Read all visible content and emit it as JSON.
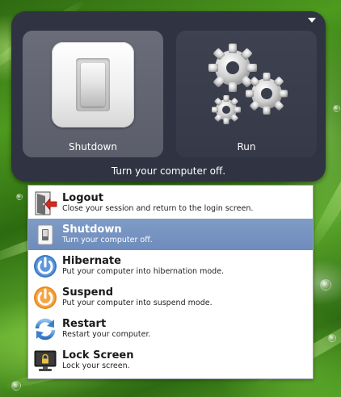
{
  "panel": {
    "caption": "Turn your computer off.",
    "tiles": [
      {
        "label": "Shutdown",
        "selected": true
      },
      {
        "label": "Run",
        "selected": false
      }
    ]
  },
  "menu": {
    "items": [
      {
        "title": "Logout",
        "desc": "Close your session and return to the login screen.",
        "icon": "logout-icon"
      },
      {
        "title": "Shutdown",
        "desc": "Turn your computer off.",
        "icon": "power-switch-icon",
        "selected": true
      },
      {
        "title": "Hibernate",
        "desc": "Put your computer into hibernation mode.",
        "icon": "hibernate-power-icon"
      },
      {
        "title": "Suspend",
        "desc": "Put your computer into suspend mode.",
        "icon": "suspend-power-icon"
      },
      {
        "title": "Restart",
        "desc": "Restart your computer.",
        "icon": "restart-icon"
      },
      {
        "title": "Lock Screen",
        "desc": "Lock your screen.",
        "icon": "lock-screen-icon"
      }
    ]
  },
  "colors": {
    "panel_bg": "#2f3342",
    "tile_selected": "#5f626e",
    "menu_selected": "#7390c0",
    "hibernate_blue": "#3a78c2",
    "suspend_orange": "#e88b1c"
  }
}
